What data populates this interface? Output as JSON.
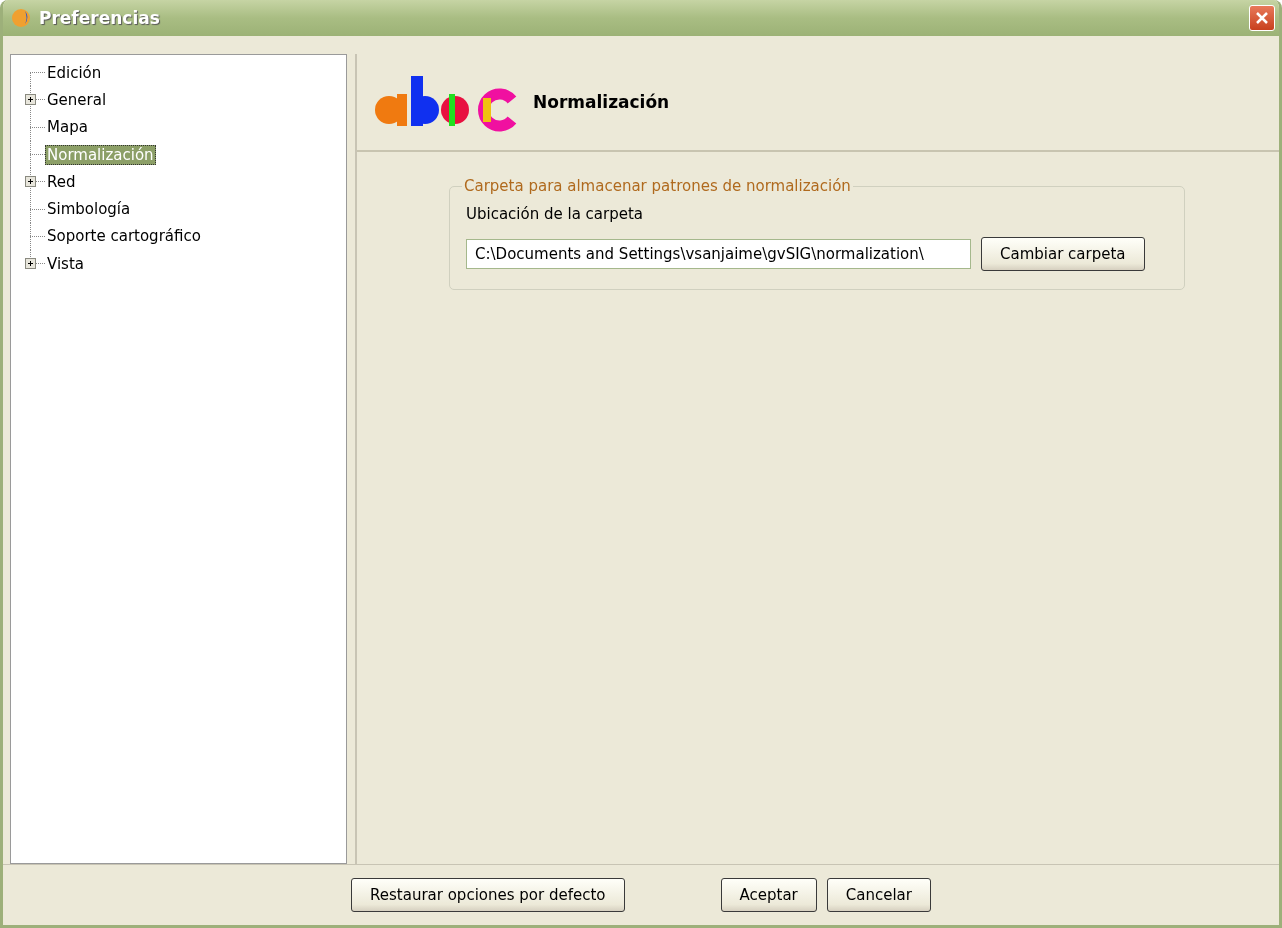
{
  "window": {
    "title": "Preferencias"
  },
  "tree": {
    "items": [
      {
        "label": "Edición",
        "has_children": false,
        "selected": false
      },
      {
        "label": "General",
        "has_children": true,
        "selected": false
      },
      {
        "label": "Mapa",
        "has_children": false,
        "selected": false
      },
      {
        "label": "Normalización",
        "has_children": false,
        "selected": true
      },
      {
        "label": "Red",
        "has_children": true,
        "selected": false
      },
      {
        "label": "Simbología",
        "has_children": false,
        "selected": false
      },
      {
        "label": "Soporte cartográfico",
        "has_children": false,
        "selected": false
      },
      {
        "label": "Vista",
        "has_children": true,
        "selected": false
      }
    ]
  },
  "page": {
    "title": "Normalización",
    "group": {
      "legend": "Carpeta para almacenar patrones de normalización",
      "label": "Ubicación de la carpeta",
      "value": "C:\\Documents and Settings\\vsanjaime\\gvSIG\\normalization\\",
      "button": "Cambiar carpeta"
    }
  },
  "buttons": {
    "restore": "Restaurar opciones por defecto",
    "ok": "Aceptar",
    "cancel": "Cancelar"
  }
}
